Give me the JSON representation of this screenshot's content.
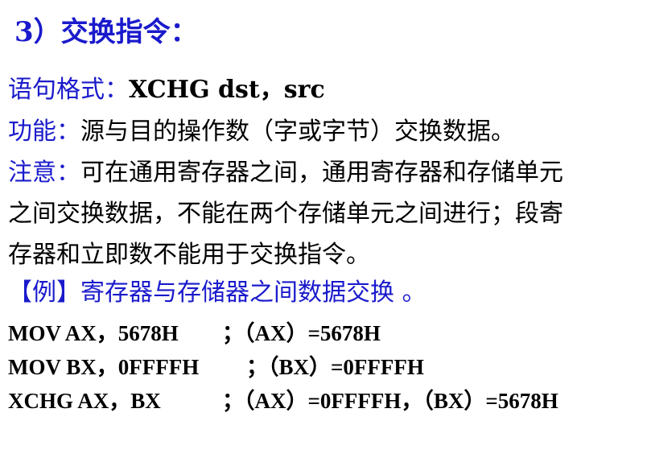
{
  "title": "3）交换指令：",
  "syntax": {
    "label": "语句格式：",
    "value": "XCHG dst，src"
  },
  "function": {
    "label": "功能：",
    "text": "源与目的操作数（字或字节）交换数据。"
  },
  "note": {
    "label": "注意：",
    "line1": "可在通用寄存器之间，通用寄存器和存储单元",
    "line2": "之间交换数据，不能在两个存储单元之间进行；段寄",
    "line3": "存器和立即数不能用于交换指令。"
  },
  "example": {
    "label": "【例】寄存器与存储器之间数据交换 。"
  },
  "code": [
    {
      "instr": "MOV  AX，5678H",
      "comment": "；（AX）=5678H"
    },
    {
      "instr": "MOV  BX，0FFFFH",
      "comment": "；（BX）=0FFFFH"
    },
    {
      "instr": "XCHG   AX，BX",
      "comment": "；（AX）=0FFFFH，（BX）=5678H"
    }
  ],
  "colors": {
    "accent": "#1a1acc",
    "text": "#000000"
  }
}
